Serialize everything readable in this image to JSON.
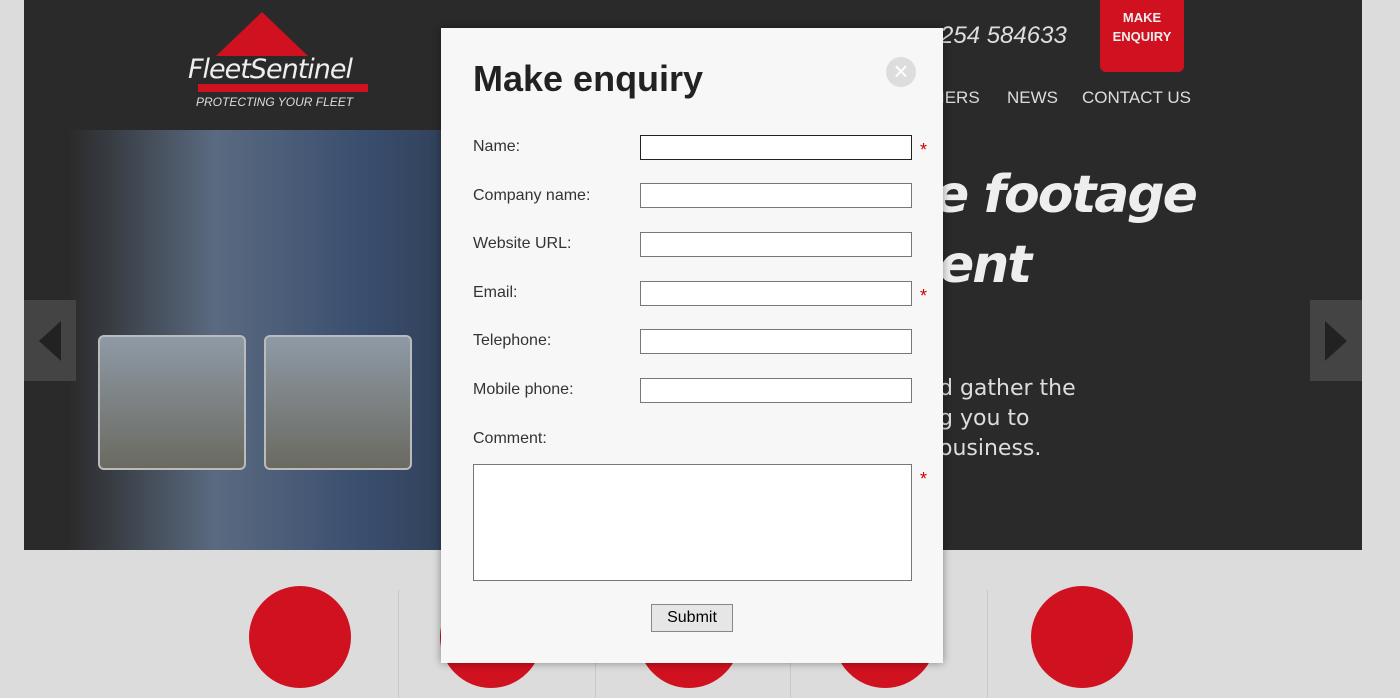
{
  "header": {
    "logo_name": "FleetSentinel",
    "logo_tagline": "PROTECTING YOUR FLEET",
    "phone": "254 584633",
    "enquiry_badge": [
      "MAKE",
      "ENQUIRY"
    ],
    "nav": [
      "IERS",
      "NEWS",
      "CONTACT US"
    ]
  },
  "hero": {
    "headline": [
      "e footage",
      "ent"
    ],
    "paragraph": [
      "d gather the",
      "g you to",
      "ousiness."
    ]
  },
  "modal": {
    "title": "Make enquiry",
    "fields": [
      {
        "label": "Name:",
        "value": "",
        "required": true
      },
      {
        "label": "Company name:",
        "value": "",
        "required": false
      },
      {
        "label": "Website URL:",
        "value": "",
        "required": false
      },
      {
        "label": "Email:",
        "value": "",
        "required": true
      },
      {
        "label": "Telephone:",
        "value": "",
        "required": false
      },
      {
        "label": "Mobile phone:",
        "value": "",
        "required": false
      }
    ],
    "comment_label": "Comment:",
    "comment_value": "",
    "required_mark": "*",
    "submit": "Submit",
    "close_icon": "close-icon"
  },
  "colors": {
    "brand_red": "#d0111f",
    "header_bg": "#2a2a2a"
  }
}
